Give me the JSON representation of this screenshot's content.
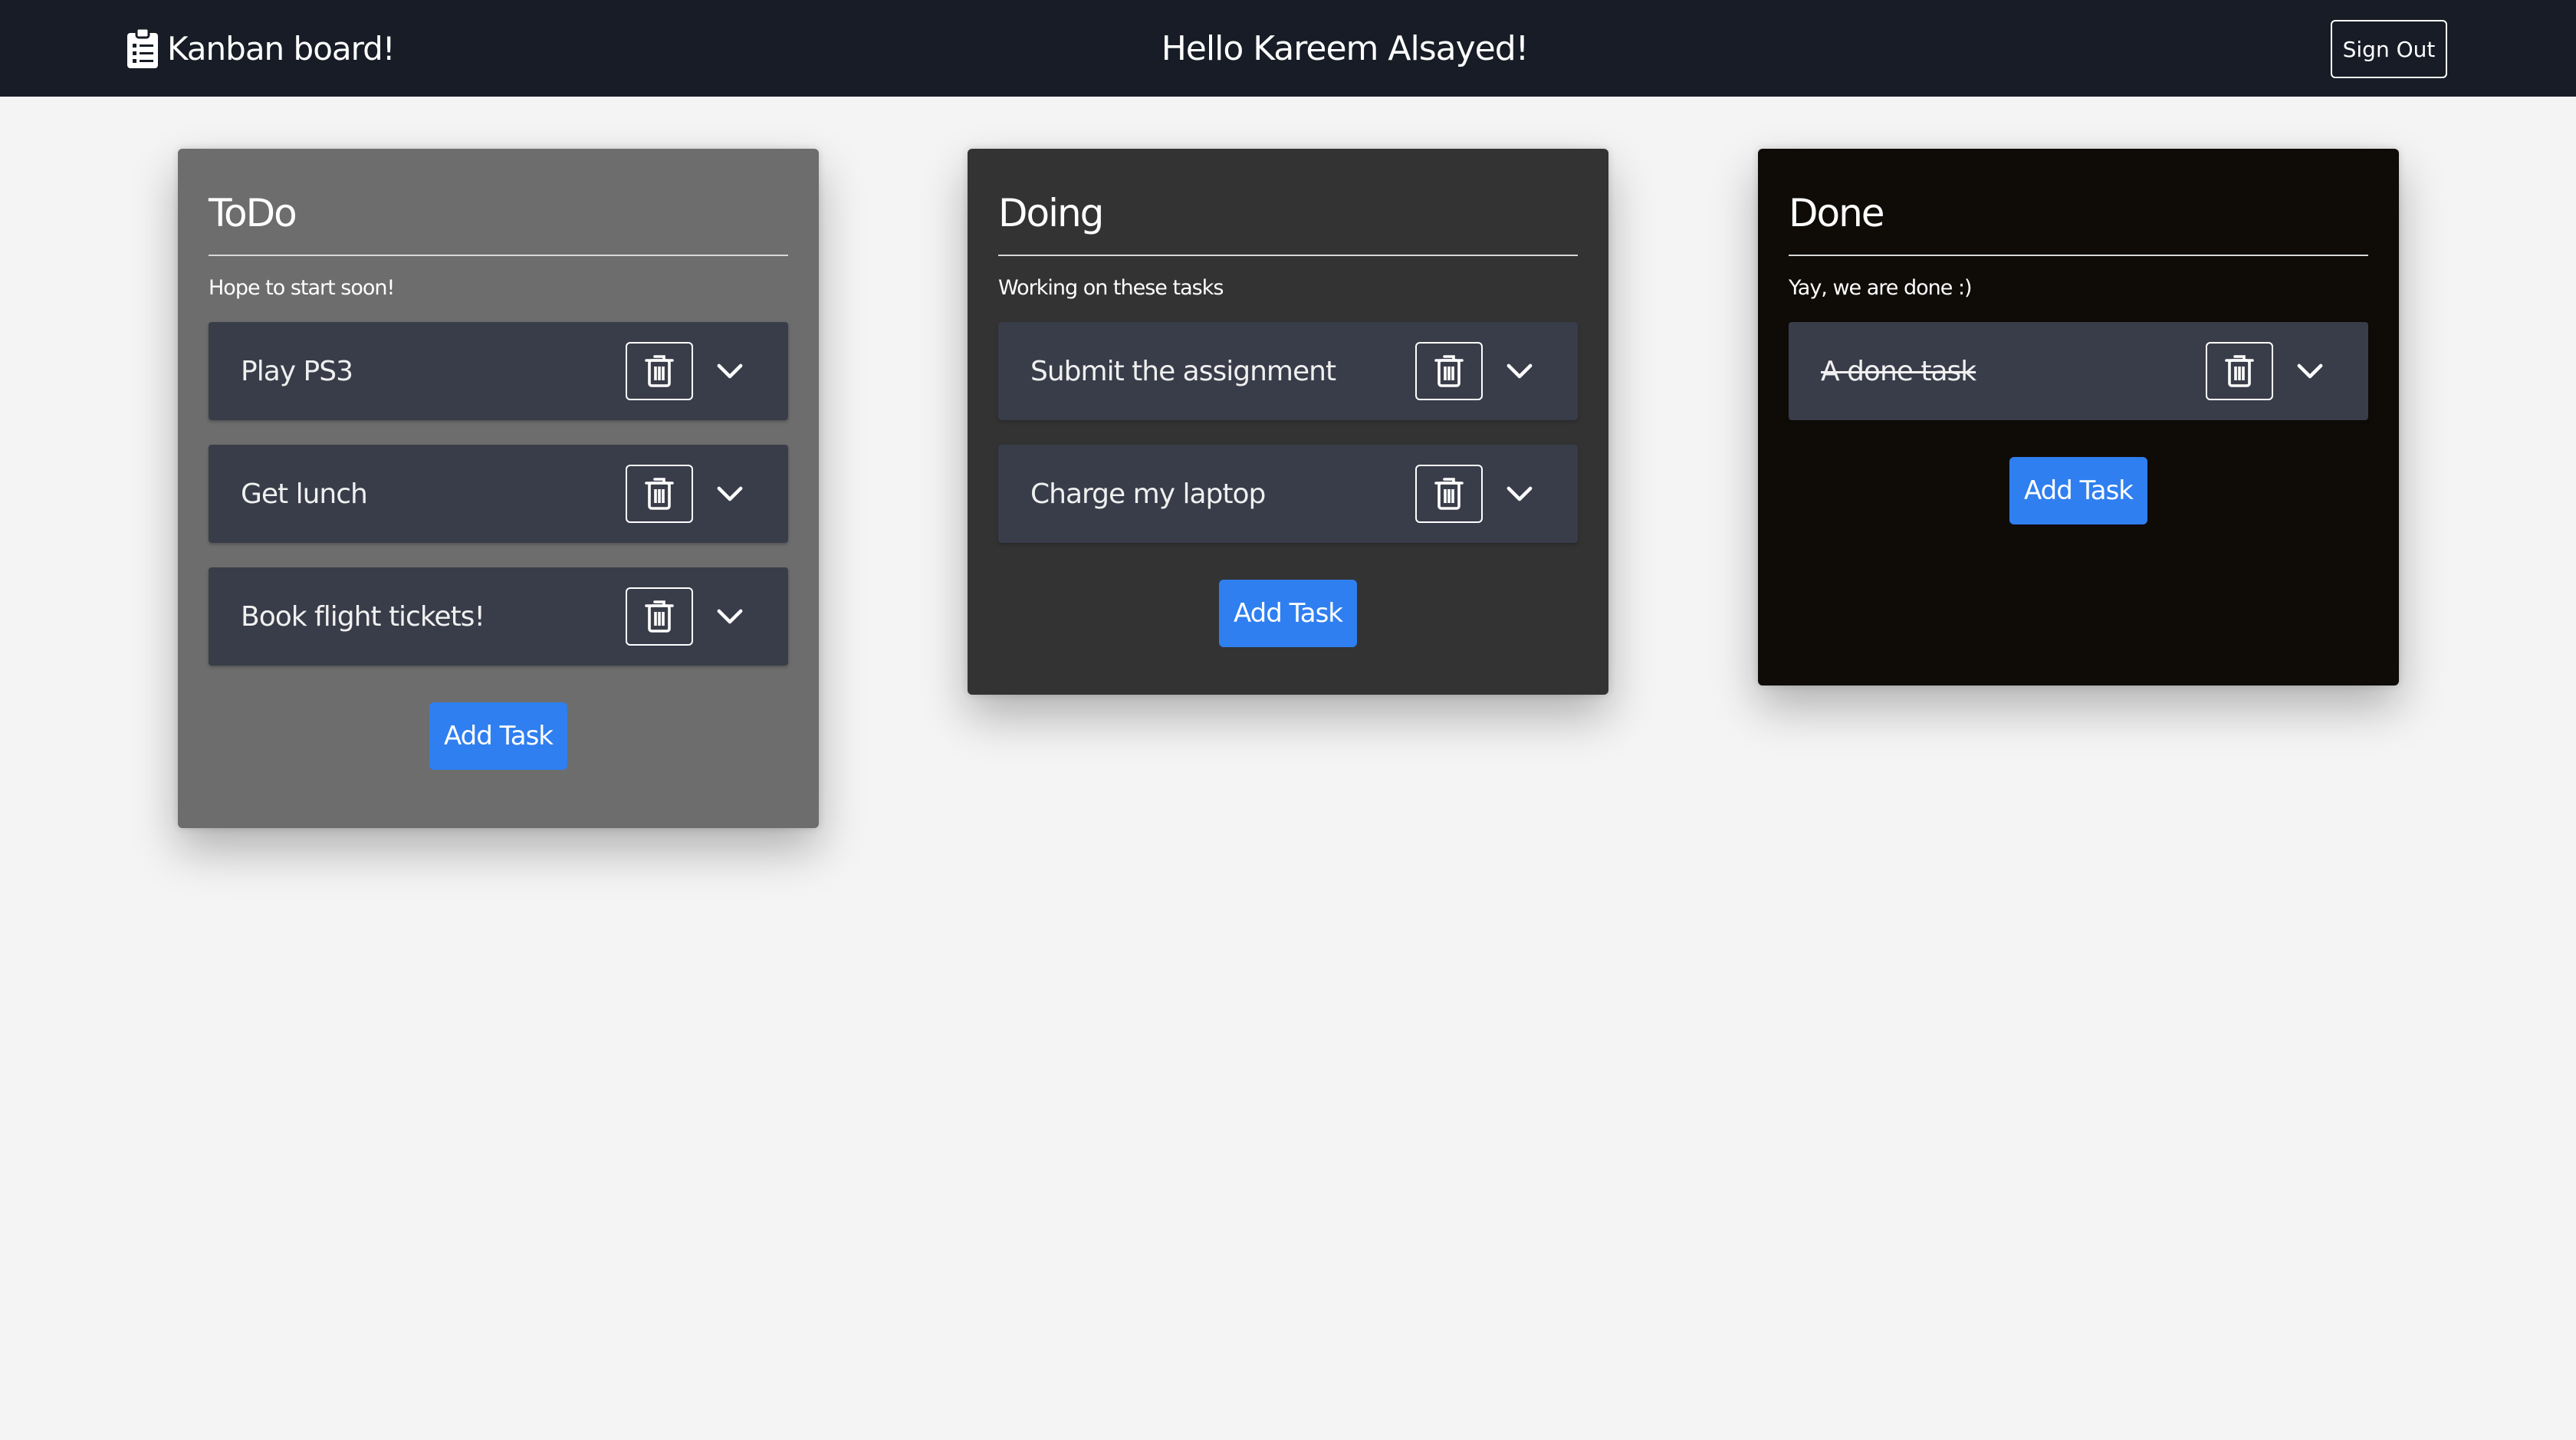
{
  "navbar": {
    "brand": "Kanban board!",
    "greeting": "Hello Kareem Alsayed!",
    "sign_out": "Sign Out"
  },
  "columns": [
    {
      "title": "ToDo",
      "subtitle": "Hope to start soon!",
      "background": "#6d6d6d",
      "tasks": [
        {
          "label": "Play PS3",
          "done": false
        },
        {
          "label": "Get lunch",
          "done": false
        },
        {
          "label": "Book flight tickets!",
          "done": false
        }
      ],
      "add_label": "Add Task"
    },
    {
      "title": "Doing",
      "subtitle": "Working on these tasks",
      "background": "#333333",
      "tasks": [
        {
          "label": "Submit the assignment",
          "done": false
        },
        {
          "label": "Charge my laptop",
          "done": false
        }
      ],
      "add_label": "Add Task"
    },
    {
      "title": "Done",
      "subtitle": "Yay, we are done :)",
      "background": "#0f0c07",
      "tasks": [
        {
          "label": "A done task",
          "done": true
        }
      ],
      "add_label": "Add Task"
    }
  ],
  "colors": {
    "navbar": "#171c26",
    "page": "#f4f4f4",
    "task_card": "#393d4a",
    "accent": "#2f7ff0"
  },
  "icons": {
    "brand": "clipboard-list-icon",
    "delete": "trash-icon",
    "expand": "chevron-down-icon"
  }
}
